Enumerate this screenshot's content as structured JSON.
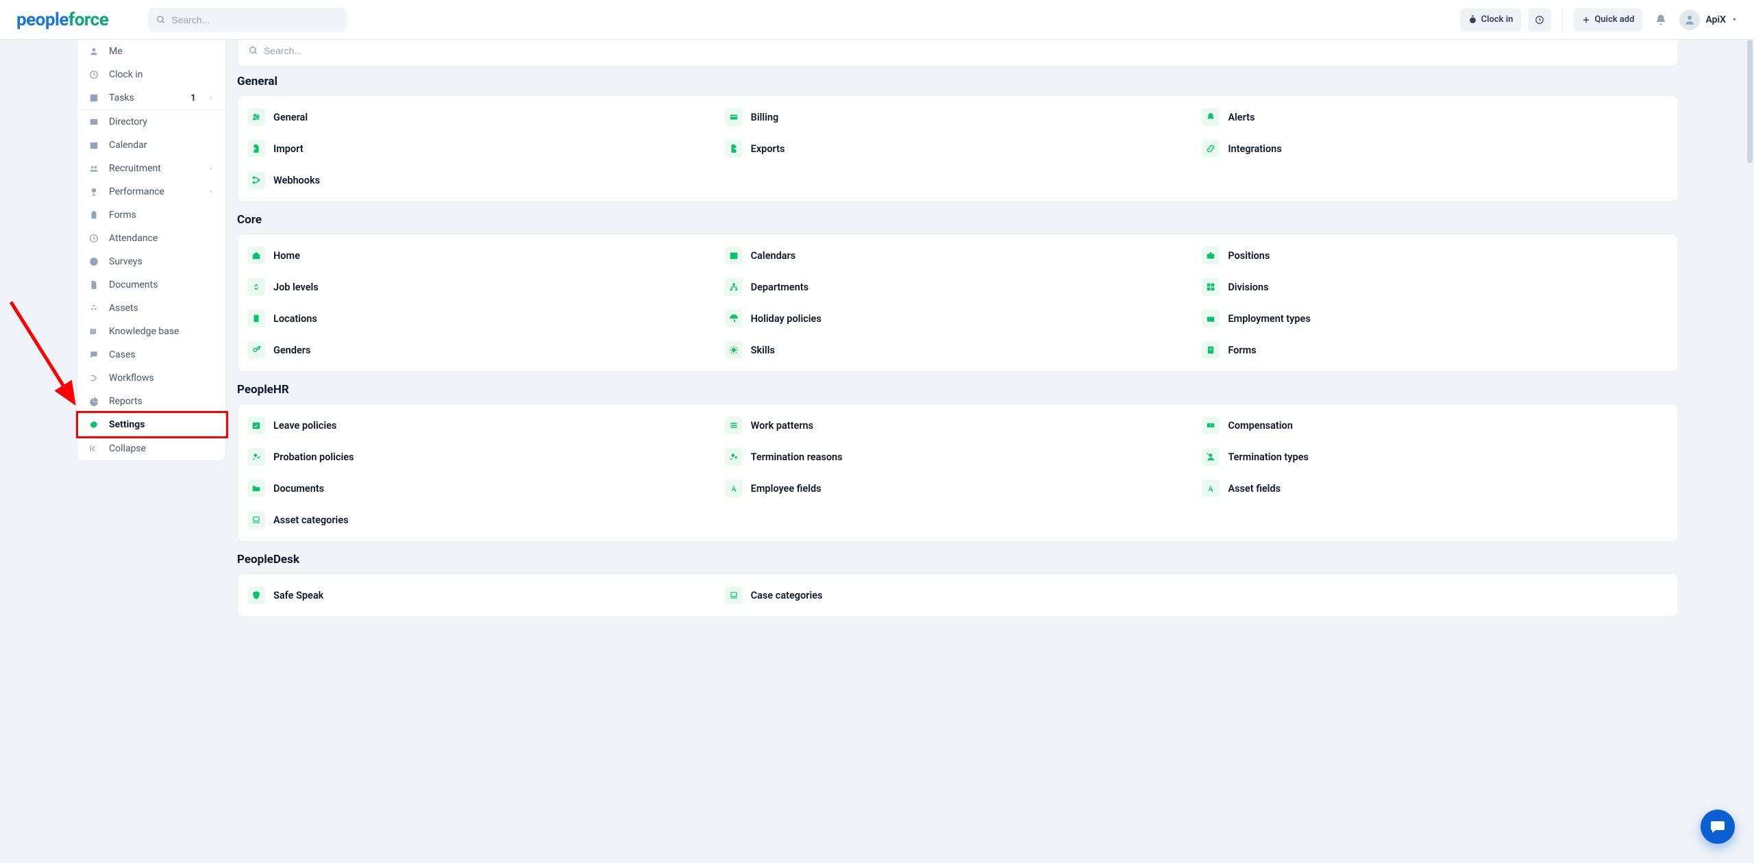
{
  "header": {
    "logo_part1": "people",
    "logo_part2": "force",
    "search_placeholder": "Search...",
    "clockin_label": "Clock in",
    "quickadd_label": "Quick add",
    "user_name": "ApiX"
  },
  "sidebar": {
    "section1": [
      {
        "label": "Me",
        "icon": "user-icon"
      },
      {
        "label": "Clock in",
        "icon": "clock-icon"
      },
      {
        "label": "Tasks",
        "icon": "check-square-icon",
        "badge": "1",
        "chevron": true
      }
    ],
    "section2": [
      {
        "label": "Directory",
        "icon": "id-card-icon"
      },
      {
        "label": "Calendar",
        "icon": "calendar-icon"
      },
      {
        "label": "Recruitment",
        "icon": "people-group-icon",
        "chevron": true
      },
      {
        "label": "Performance",
        "icon": "trophy-icon",
        "chevron": true
      },
      {
        "label": "Forms",
        "icon": "clipboard-icon"
      },
      {
        "label": "Attendance",
        "icon": "clock-icon"
      },
      {
        "label": "Surveys",
        "icon": "heart-circle-icon"
      },
      {
        "label": "Documents",
        "icon": "file-icon"
      },
      {
        "label": "Assets",
        "icon": "cubes-icon"
      },
      {
        "label": "Knowledge base",
        "icon": "books-icon"
      },
      {
        "label": "Cases",
        "icon": "comment-icon"
      },
      {
        "label": "Workflows",
        "icon": "flow-icon"
      },
      {
        "label": "Reports",
        "icon": "pie-icon"
      },
      {
        "label": "Settings",
        "icon": "gear-icon",
        "active": true
      }
    ],
    "section3": [
      {
        "label": "Collapse",
        "icon": "collapse-icon"
      }
    ]
  },
  "main": {
    "search_placeholder": "Search...",
    "sections": [
      {
        "title": "General",
        "items": [
          {
            "label": "General",
            "icon": "sliders-icon"
          },
          {
            "label": "Billing",
            "icon": "credit-card-icon"
          },
          {
            "label": "Alerts",
            "icon": "bell-icon"
          },
          {
            "label": "Import",
            "icon": "file-import-icon"
          },
          {
            "label": "Exports",
            "icon": "file-export-icon"
          },
          {
            "label": "Integrations",
            "icon": "link-icon"
          },
          {
            "label": "Webhooks",
            "icon": "branch-icon"
          }
        ]
      },
      {
        "title": "Core",
        "items": [
          {
            "label": "Home",
            "icon": "home-icon"
          },
          {
            "label": "Calendars",
            "icon": "calendar-icon"
          },
          {
            "label": "Positions",
            "icon": "briefcase-icon"
          },
          {
            "label": "Job levels",
            "icon": "updown-icon"
          },
          {
            "label": "Departments",
            "icon": "sitemap-icon"
          },
          {
            "label": "Divisions",
            "icon": "grid-icon"
          },
          {
            "label": "Locations",
            "icon": "building-icon"
          },
          {
            "label": "Holiday policies",
            "icon": "umbrella-icon"
          },
          {
            "label": "Employment types",
            "icon": "briefcase-gear-icon"
          },
          {
            "label": "Genders",
            "icon": "gender-icon"
          },
          {
            "label": "Skills",
            "icon": "star-burst-icon"
          },
          {
            "label": "Forms",
            "icon": "form-icon"
          }
        ]
      },
      {
        "title": "PeopleHR",
        "items": [
          {
            "label": "Leave policies",
            "icon": "calendar-check-icon"
          },
          {
            "label": "Work patterns",
            "icon": "list-icon"
          },
          {
            "label": "Compensation",
            "icon": "money-icon"
          },
          {
            "label": "Probation policies",
            "icon": "user-check-icon"
          },
          {
            "label": "Termination reasons",
            "icon": "user-x-icon"
          },
          {
            "label": "Termination types",
            "icon": "user-slash-icon"
          },
          {
            "label": "Documents",
            "icon": "folder-icon"
          },
          {
            "label": "Employee fields",
            "icon": "font-icon"
          },
          {
            "label": "Asset fields",
            "icon": "font-icon"
          },
          {
            "label": "Asset categories",
            "icon": "laptop-icon"
          }
        ]
      },
      {
        "title": "PeopleDesk",
        "items": [
          {
            "label": "Safe Speak",
            "icon": "shield-icon"
          },
          {
            "label": "Case categories",
            "icon": "laptop-icon"
          }
        ]
      }
    ]
  }
}
